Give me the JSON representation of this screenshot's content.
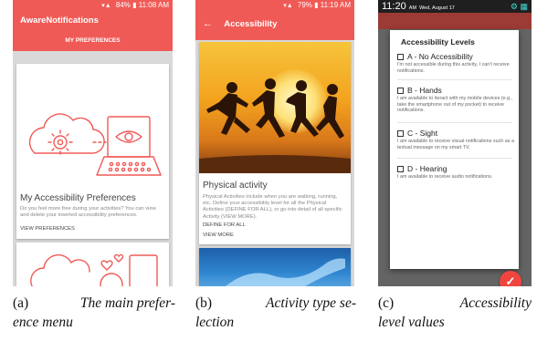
{
  "panel1": {
    "status_time": "11:08 AM",
    "status_battery": "84%",
    "app_title": "AwareNotifications",
    "tab": "MY PREFERENCES",
    "card_title": "My Accessibility Preferences",
    "card_desc": "Do you feel more free during your activities? You can view and delete your inserted accessibility preferences.",
    "card_link": "VIEW PREFERENCES"
  },
  "panel2": {
    "status_time": "11:19 AM",
    "status_battery": "79%",
    "title": "Accessibility",
    "back_icon": "←",
    "card_title": "Physical activity",
    "card_desc": "Physical Activities include when you are walking, running, etc. Define your accessibility level for all the Physical Activities (DEFINE FOR ALL), or go into detail of all specific Activity (VIEW MORE).",
    "link1": "DEFINE FOR ALL",
    "link2": "VIEW MORE"
  },
  "panel3": {
    "time": "11:20",
    "ampm": "AM",
    "date": "Wed, August 17",
    "dialog_title": "Accessibility Levels",
    "levels": [
      {
        "label": "A - No Accessibility",
        "desc": "I'm not accessible during this activity, I can't receive notifications."
      },
      {
        "label": "B - Hands",
        "desc": "I am available to iteract with my mobile devices (e.g., take the smartphone out of my pocket) to receive notifications."
      },
      {
        "label": "C - Sight",
        "desc": "I am available to receive visual notifications such as a textual message on my smart TV."
      },
      {
        "label": "D - Hearing",
        "desc": "I am available to receive audio notifications."
      }
    ],
    "fab_icon": "✓"
  },
  "captions": {
    "a_label": "(a)",
    "a_l1": "The main prefer-",
    "a_l2": "ence menu",
    "b_label": "(b)",
    "b_l1": "Activity type se-",
    "b_l2": "lection",
    "c_label": "(c)",
    "c_l1": "Accessibility",
    "c_l2": "level values"
  },
  "colors": {
    "accent": "#f05a56",
    "fab": "#f0453f",
    "teal_icons": "#3fd9d2"
  }
}
